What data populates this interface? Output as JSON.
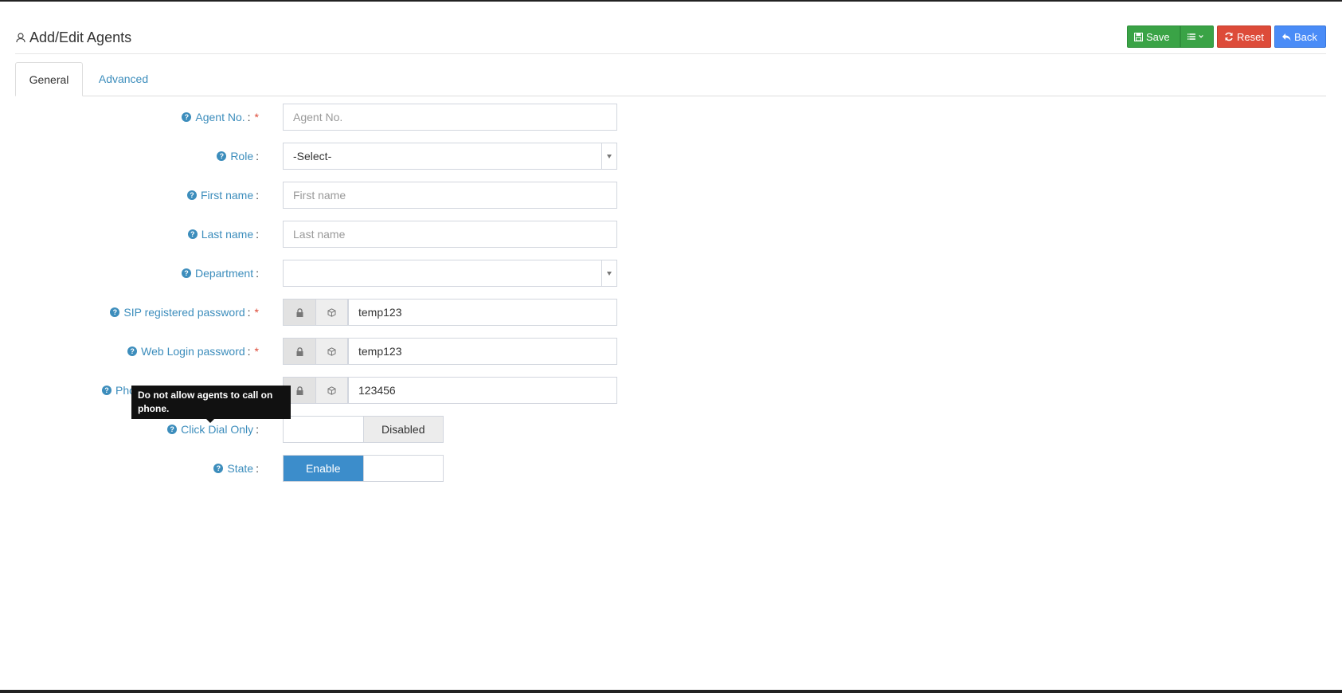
{
  "header": {
    "title": "Add/Edit Agents",
    "title_icon": "agent-icon"
  },
  "toolbar": {
    "save_label": "Save",
    "list_icon": "list-icon",
    "reset_label": "Reset",
    "back_label": "Back"
  },
  "tabs": [
    {
      "label": "General",
      "active": true
    },
    {
      "label": "Advanced",
      "active": false
    }
  ],
  "form": {
    "agent_no": {
      "label": "Agent No.",
      "required": true,
      "placeholder": "Agent No.",
      "value": ""
    },
    "role": {
      "label": "Role",
      "value": "-Select-"
    },
    "first_name": {
      "label": "First name",
      "placeholder": "First name",
      "value": ""
    },
    "last_name": {
      "label": "Last name",
      "placeholder": "Last name",
      "value": ""
    },
    "department": {
      "label": "Department",
      "value": ""
    },
    "sip_password": {
      "label": "SIP registered password",
      "required": true,
      "value": "temp123"
    },
    "web_password": {
      "label": "Web Login password",
      "required": true,
      "value": "temp123"
    },
    "phone_password": {
      "label": "Pho",
      "value": "123456"
    },
    "click_dial_only": {
      "label": "Click Dial Only",
      "state_label": "Disabled"
    },
    "state": {
      "label": "State",
      "state_label": "Enable"
    }
  },
  "colon": ":",
  "required_mark": "*",
  "tooltip": {
    "text": "Do not allow agents to call on phone."
  },
  "colors": {
    "save": "#3aa346",
    "reset": "#dd4b39",
    "back": "#4a8cf7",
    "label": "#3c8dbc",
    "toggle_on": "#3c8dcb"
  }
}
